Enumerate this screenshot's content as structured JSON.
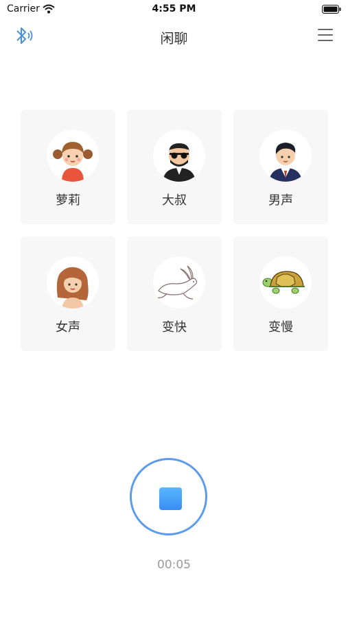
{
  "status_bar": {
    "carrier": "Carrier",
    "time": "4:55 PM"
  },
  "nav": {
    "title": "闲聊"
  },
  "voices": [
    {
      "label": "萝莉",
      "icon": "little-girl-avatar-icon"
    },
    {
      "label": "大叔",
      "icon": "uncle-avatar-icon"
    },
    {
      "label": "男声",
      "icon": "man-avatar-icon"
    },
    {
      "label": "女声",
      "icon": "woman-avatar-icon"
    },
    {
      "label": "变快",
      "icon": "rabbit-icon"
    },
    {
      "label": "变慢",
      "icon": "turtle-icon"
    }
  ],
  "recorder": {
    "timer": "00:05",
    "state": "recording"
  },
  "colors": {
    "accent": "#5b9bea",
    "card_bg": "#f7f7f7",
    "timer": "#9a9a9a"
  }
}
